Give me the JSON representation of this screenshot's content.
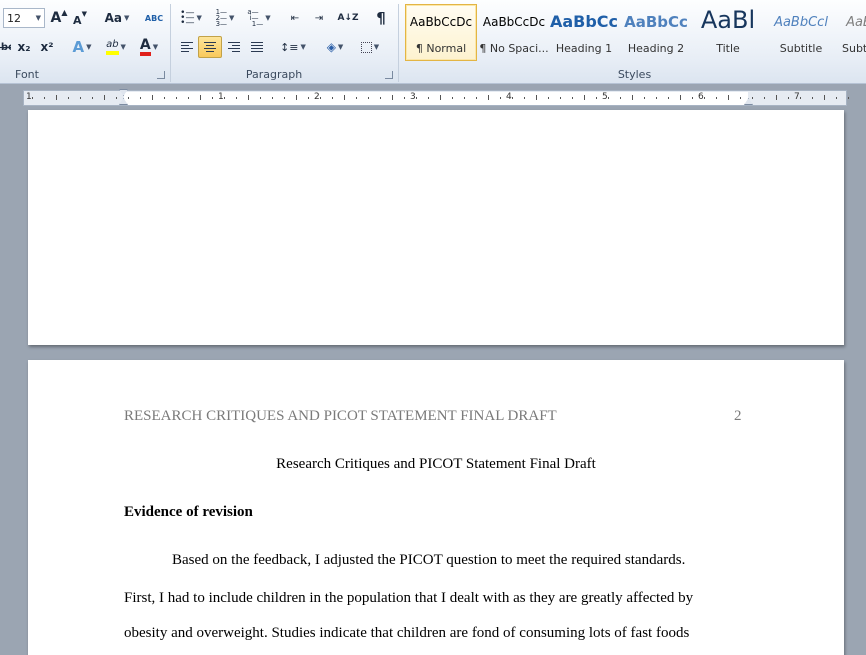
{
  "ribbon": {
    "font_group": {
      "label": "Font",
      "font_size": "12",
      "grow_label": "A",
      "shrink_label": "A",
      "case_label": "Aa",
      "clear_format_label": "ABC",
      "strike_label": "abc",
      "subscript_label": "x₂",
      "superscript_label": "x²",
      "effects_label": "A",
      "highlight_label": "ab",
      "font_color_label": "A"
    },
    "paragraph_group": {
      "label": "Paragraph",
      "pilcrow_label": "¶",
      "sort_label": "A↓Z"
    },
    "styles_group": {
      "label": "Styles",
      "items": [
        {
          "sample": "AaBbCcDc",
          "name": "¶ Normal",
          "selected": true
        },
        {
          "sample": "AaBbCcDc",
          "name": "¶ No Spaci..."
        },
        {
          "sample": "AaBbCc",
          "name": "Heading 1"
        },
        {
          "sample": "AaBbCc",
          "name": "Heading 2"
        },
        {
          "sample": "AaBl",
          "name": "Title"
        },
        {
          "sample": "AaBbCcl",
          "name": "Subtitle"
        },
        {
          "sample": "AaBbCcl",
          "name": "Subtl"
        }
      ]
    }
  },
  "ruler": {
    "numbers": [
      "1",
      "1",
      "2",
      "3",
      "4",
      "5",
      "6",
      "7"
    ]
  },
  "document": {
    "running_head": "RESEARCH CRITIQUES AND PICOT STATEMENT FINAL DRAFT",
    "page_number": "2",
    "title": "Research Critiques and PICOT Statement Final Draft",
    "heading": "Evidence of revision",
    "lines": [
      "Based on the feedback, I adjusted the PICOT question to meet the required standards.",
      "First, I had to include children in the population that I dealt with as they are greatly affected by",
      "obesity and overweight. Studies indicate that children are fond of consuming lots of fast foods"
    ]
  },
  "colors": {
    "heading1": "#1f5fa8",
    "heading2": "#4f81bd",
    "title": "#17365d",
    "subtitle": "#4f81bd",
    "highlight": "#ffff00",
    "font_color": "#e0201b",
    "running_head": "#7a7a7a"
  }
}
